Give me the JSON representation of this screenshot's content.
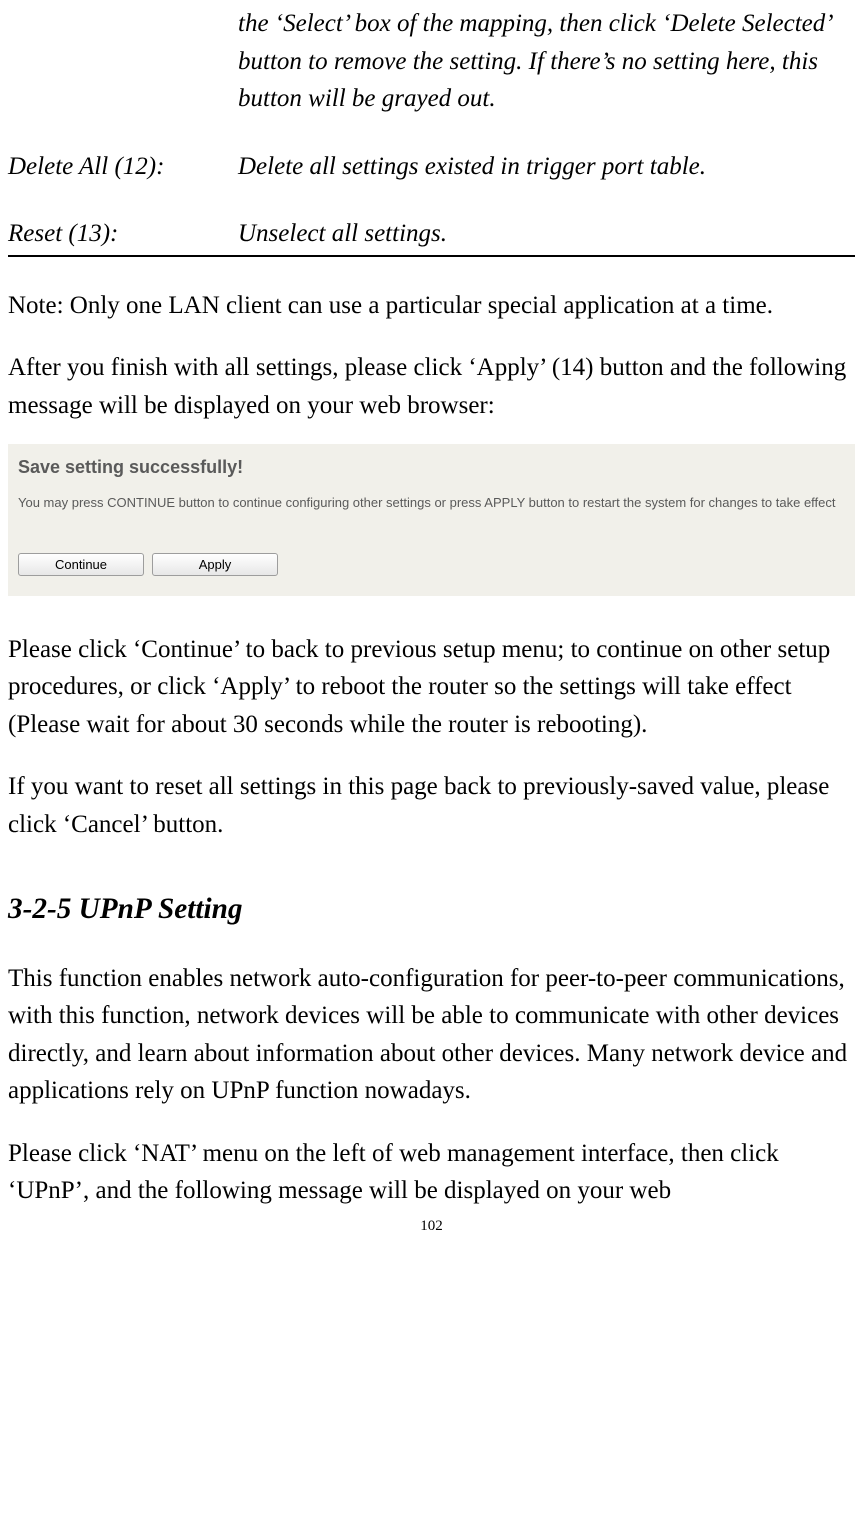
{
  "definitions": {
    "first_desc": "the ‘Select’ box of the mapping, then click ‘Delete Selected’ button to remove the setting. If there’s no setting here, this button will be grayed out.",
    "delete_all": {
      "label": "Delete All (12):",
      "desc": "Delete all settings existed in trigger port table."
    },
    "reset": {
      "label": "Reset (13):",
      "desc": "Unselect all settings."
    }
  },
  "note": "Note: Only one LAN client can use a particular special application at a time.",
  "para_apply": "After you finish with all settings, please click ‘Apply’ (14) button and the following message will be displayed on your web browser:",
  "screenshot": {
    "title": "Save setting successfully!",
    "text": "You may press CONTINUE button to continue configuring other settings or press APPLY button to restart the system for changes to take effect",
    "btn_continue": "Continue",
    "btn_apply": "Apply"
  },
  "para_continue": "Please click ‘Continue’ to back to previous setup menu; to continue on other setup procedures, or click ‘Apply’ to reboot the router so the settings will take effect (Please wait for about 30 seconds while the router is rebooting).",
  "para_reset": "If you want to reset all settings in this page back to previously-saved value, please click ‘Cancel’ button.",
  "section_heading": "3-2-5 UPnP Setting",
  "para_upnp1": "This function enables network auto-configuration for peer-to-peer communications, with this function, network devices will be able to communicate with other devices directly, and learn about information about other devices. Many network device and applications rely on UPnP function nowadays.",
  "para_upnp2": "Please click ‘NAT’ menu on the left of web management interface, then click ‘UPnP’, and the following message will be displayed on your web",
  "page_number": "102"
}
